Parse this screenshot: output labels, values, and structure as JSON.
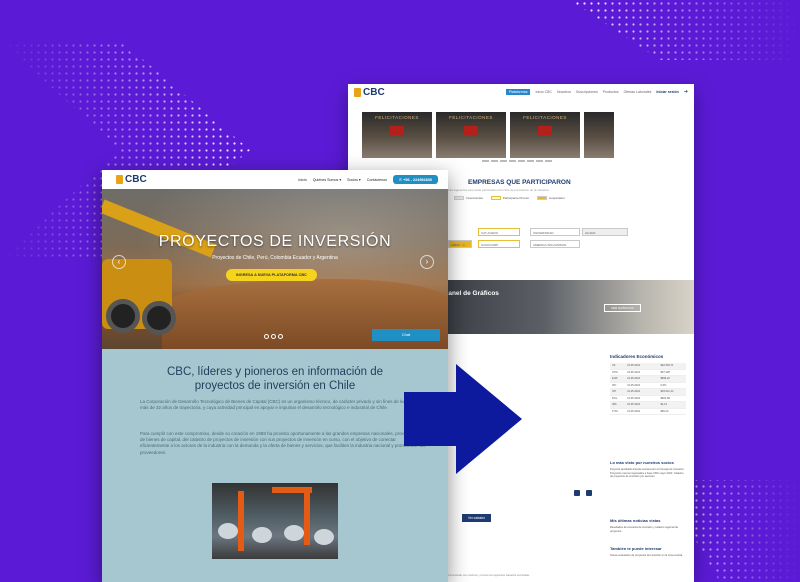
{
  "colors": {
    "background": "#5b1bd6",
    "arrow": "#0d1a9e",
    "accent_blue": "#1f8fc4",
    "brand_navy": "#1d3b70",
    "cta_yellow": "#f6d41c",
    "body_teal": "#a6c7cf"
  },
  "back_screenshot": {
    "logo": "CBC",
    "nav": [
      "Plataformas",
      "Inicio CBC",
      "Nosotros",
      "Suscripciones",
      "Productos",
      "Ofertas Laborales"
    ],
    "nav_actions": [
      "Iniciar sesión"
    ],
    "gallery_caption": "FELICITACIONES",
    "companies_title": "EMPRESAS QUE PARTICIPARON",
    "companies_subtitle": "Las siguientes empresas participaron del ciclo de premiación de la industria",
    "legend": [
      "Inversionista",
      "Participante Premio",
      "Auspiciador"
    ],
    "fields": [
      "CAT ACERO",
      "UNIVERSIDAD",
      "HUARA",
      "LIBRO · C...",
      "GOLDCORP",
      "AMERICA WILLIAMSON"
    ],
    "graphs_title": "Panel de Gráficos",
    "graphs_button": "VER GRÁFICOS",
    "indicators_title": "Indicadores Económicos",
    "indicators": [
      [
        "UF",
        "31.05.2022",
        "$32.593,71"
      ],
      [
        "UTM",
        "31.05.2022",
        "$57.328"
      ],
      [
        "EUR",
        "31.05.2022",
        "$896,22"
      ],
      [
        "IPC",
        "31.05.2022",
        "0,6%"
      ],
      [
        "IVP",
        "31.05.2022",
        "$33.512,44"
      ],
      [
        "DOL",
        "31.05.2022",
        "$822,68"
      ],
      [
        "IMA",
        "31.05.2022",
        "$4,13"
      ],
      [
        "TCM",
        "31.05.2022",
        "$96,23"
      ]
    ],
    "side_most_viewed_title": "Lo más visto por nuestros socios",
    "side_most_viewed_text": "Proyecto aprobado durante semana por el Consejo de Inversión. Proyectos nuevos ingresados a base CBC mayo 2022. Catastro de proyectos de inversión por sectores.",
    "side_latest_title": "Mis últimas noticias vistas",
    "side_latest_text": "Resultados de encuesta de inversión y catastro regional de proyectos.",
    "side_interest_title": "También te puede interesar",
    "side_interest_text": "Nueva evaluación de proyectos de inversión en la zona central.",
    "cta_button": "Ver catastro",
    "footer_note": "Comunícate con nosotros y conoce los siguientes catastros sectoriales"
  },
  "front_screenshot": {
    "logo": "CBC",
    "nav": [
      "Inicio",
      "Quiénes Somos ▾",
      "Socios ▾",
      "Contáctenos"
    ],
    "phone": "+56 - 224952830",
    "hero_title": "PROYECTOS DE INVERSIÓN",
    "hero_subtitle": "Proyectos de Chile, Perú, Colombia Ecuador y Argentina",
    "hero_button": "INGRESA A NUEVA PLATAFORMA CBC",
    "chat_label": "Chat",
    "section_title_line1": "CBC, líderes y pioneros en información de",
    "section_title_line2": "proyectos de inversión en Chile",
    "paragraph_1": "La Corporación de Desarrollo Tecnológico de Bienes de Capital (CBC) es un organismo técnico, de carácter privado y sin fines de lucro, con más de 32 años de trayectoria, y cuya actividad principal es apoyar e impulsar el desarrollo tecnológico e industrial de Chile.",
    "paragraph_2": "Para cumplir con este compromiso, desde su creación en 1988 ha provisto oportunamente a las grandes empresas nacionales, proveedoras de bienes de capital, del catastro de proyectos de inversión con sus proyectos de inversión en curso, con el objetivo de conectar eficientemente a los actores de la industria con la demanda y la oferta de bienes y servicios, que faciliten la industria nacional y promuevan sus proveedores."
  }
}
